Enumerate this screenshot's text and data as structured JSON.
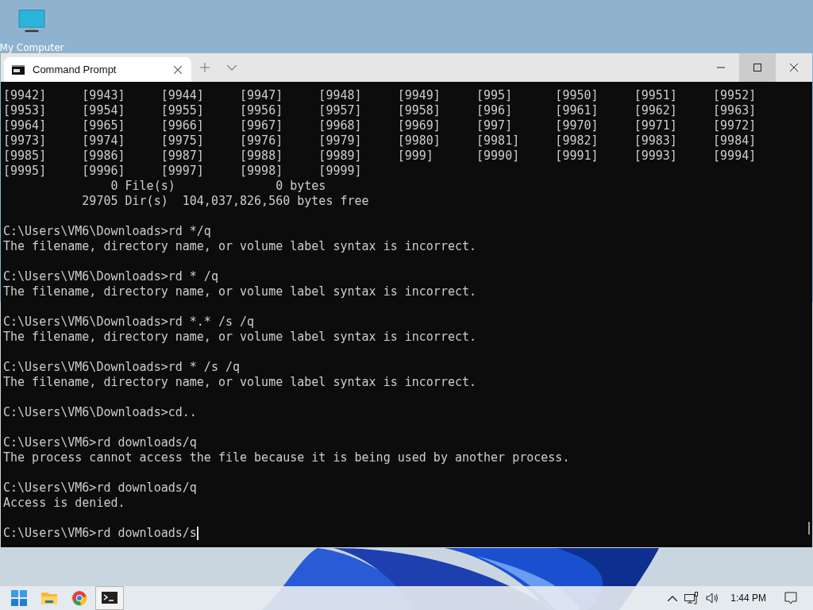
{
  "desktop": {
    "icons": [
      {
        "label": "My Computer"
      }
    ]
  },
  "window": {
    "tabs": [
      {
        "title": "Command Prompt",
        "selected": true
      }
    ],
    "controls": [
      {
        "kind": "minimize",
        "hovered": false
      },
      {
        "kind": "maximize",
        "hovered": true
      },
      {
        "kind": "close",
        "hovered": false
      }
    ]
  },
  "terminal": {
    "cursor_visible": true,
    "blocks": [
      [
        "[9942]     [9943]     [9944]     [9947]     [9948]     [9949]     [995]      [9950]     [9951]     [9952]",
        "[9953]     [9954]     [9955]     [9956]     [9957]     [9958]     [996]      [9961]     [9962]     [9963]",
        "[9964]     [9965]     [9966]     [9967]     [9968]     [9969]     [997]      [9970]     [9971]     [9972]",
        "[9973]     [9974]     [9975]     [9976]     [9979]     [9980]     [9981]     [9982]     [9983]     [9984]",
        "[9985]     [9986]     [9987]     [9988]     [9989]     [999]      [9990]     [9991]     [9993]     [9994]",
        "[9995]     [9996]     [9997]     [9998]     [9999]",
        "               0 File(s)              0 bytes",
        "           29705 Dir(s)  104,037,826,560 bytes free"
      ],
      [
        "C:\\Users\\VM6\\Downloads>rd */q",
        "The filename, directory name, or volume label syntax is incorrect."
      ],
      [
        "C:\\Users\\VM6\\Downloads>rd * /q",
        "The filename, directory name, or volume label syntax is incorrect."
      ],
      [
        "C:\\Users\\VM6\\Downloads>rd *.* /s /q",
        "The filename, directory name, or volume label syntax is incorrect."
      ],
      [
        "C:\\Users\\VM6\\Downloads>rd * /s /q",
        "The filename, directory name, or volume label syntax is incorrect."
      ],
      [
        "C:\\Users\\VM6\\Downloads>cd.."
      ],
      [
        "C:\\Users\\VM6>rd downloads/q",
        "The process cannot access the file because it is being used by another process."
      ],
      [
        "C:\\Users\\VM6>rd downloads/q",
        "Access is denied."
      ],
      [
        "C:\\Users\\VM6>rd downloads/s"
      ]
    ]
  },
  "taskbar": {
    "apps": [
      {
        "kind": "start",
        "selected": false
      },
      {
        "kind": "files",
        "selected": false
      },
      {
        "kind": "browser",
        "selected": false
      },
      {
        "kind": "terminal",
        "selected": true
      }
    ],
    "tray": {
      "clock": "1:44 PM"
    }
  }
}
